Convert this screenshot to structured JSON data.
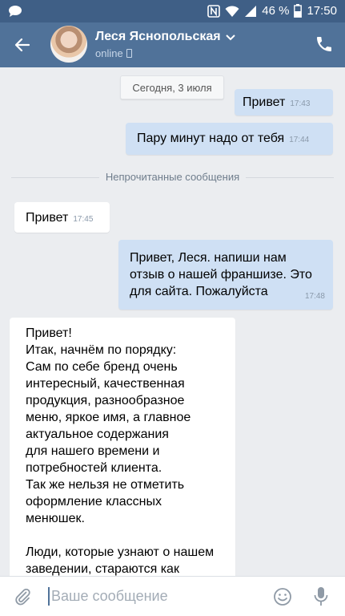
{
  "status_bar": {
    "battery_percent": "46 %",
    "time": "17:50",
    "icons": [
      "chat-bubble-icon",
      "nfc-icon",
      "wifi-icon",
      "signal-icon",
      "battery-icon"
    ]
  },
  "header": {
    "contact_name": "Леся Яснопольская",
    "presence": "online",
    "icons": [
      "back-arrow-icon",
      "chevron-down-icon",
      "mobile-phone-icon",
      "call-icon"
    ],
    "color": "#507299"
  },
  "date_separator": "Сегодня, 3 июля",
  "unread_separator": "Непрочитанные сообщения",
  "messages": [
    {
      "direction": "outgoing",
      "text": "Привет",
      "time": "17:43"
    },
    {
      "direction": "outgoing",
      "text": "Пару минут надо от тебя",
      "time": "17:44"
    },
    {
      "direction": "incoming",
      "text": "Привет",
      "time": "17:45"
    },
    {
      "direction": "outgoing",
      "text": "Привет, Леся. напиши нам\nотзыв о нашей франшизе. Это\nдля сайта. Пожалуйста",
      "time": "17:48"
    },
    {
      "direction": "incoming",
      "text": "Привет!\nИтак, начнём по порядку:\nСам по себе бренд очень\nинтересный, качественная\nпродукция, разнообразное\nменю, яркое имя, а главное\nактуальное содержания\nдля нашего времени и\nпотребностей клиента.\nТак же нельзя не отметить\nоформление классных\nменюшек.\n\nЛюди, которые узнают о нашем\nзаведении, стараются как"
    }
  ],
  "composer": {
    "placeholder": "Ваше сообщение",
    "icons": [
      "attach-icon",
      "emoji-icon",
      "microphone-icon"
    ]
  }
}
